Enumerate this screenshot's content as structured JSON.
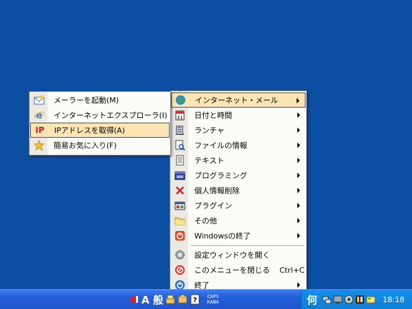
{
  "main_menu": {
    "items": [
      {
        "label": "インターネット・メール",
        "icon": "globe-icon",
        "submenu": true,
        "highlighted": true
      },
      {
        "label": "日付と時間",
        "icon": "calendar-icon",
        "submenu": true
      },
      {
        "label": "ランチャ",
        "icon": "launcher-icon",
        "submenu": true
      },
      {
        "label": "ファイルの情報",
        "icon": "file-search-icon",
        "submenu": true
      },
      {
        "label": "テキスト",
        "icon": "text-file-icon",
        "submenu": true
      },
      {
        "label": "プログラミング",
        "icon": "program-window-icon",
        "submenu": true
      },
      {
        "label": "個人情報削除",
        "icon": "red-x-icon",
        "submenu": true
      },
      {
        "label": "プラグイン",
        "icon": "plugin-icon",
        "submenu": true
      },
      {
        "label": "その他",
        "icon": "folder-icon",
        "submenu": true
      },
      {
        "label": "Windowsの終了",
        "icon": "shutdown-icon",
        "submenu": true
      },
      {
        "label": "設定ウィンドウを開く",
        "icon": "gear-icon",
        "submenu": false
      },
      {
        "label": "このメニューを閉じる",
        "shortcut": "Ctrl+C",
        "icon": "stop-icon",
        "submenu": false
      },
      {
        "label": "終了",
        "icon": "power-icon",
        "submenu": true
      }
    ]
  },
  "sub_menu": {
    "items": [
      {
        "label": "メーラーを起動(M)",
        "icon": "mail-icon"
      },
      {
        "label": "インターネットエクスプローラ(I)",
        "icon": "ie-icon"
      },
      {
        "label": "IPアドレスを取得(A)",
        "icon": "ip-icon",
        "icon_text": "IP",
        "highlighted": true
      },
      {
        "label": "簡易お気に入り(F)",
        "icon": "star-icon"
      }
    ]
  },
  "taskbar": {
    "ime_mode": "A 般",
    "ime_caps": "CAPS",
    "ime_kana": "KANA",
    "tray_kanji": "何",
    "clock": "18:18"
  },
  "colors": {
    "desktop": "#0b4ea2",
    "menu_highlight": "#fbe5b3",
    "taskbar": "#245edb",
    "tray": "#0e7fd9"
  }
}
